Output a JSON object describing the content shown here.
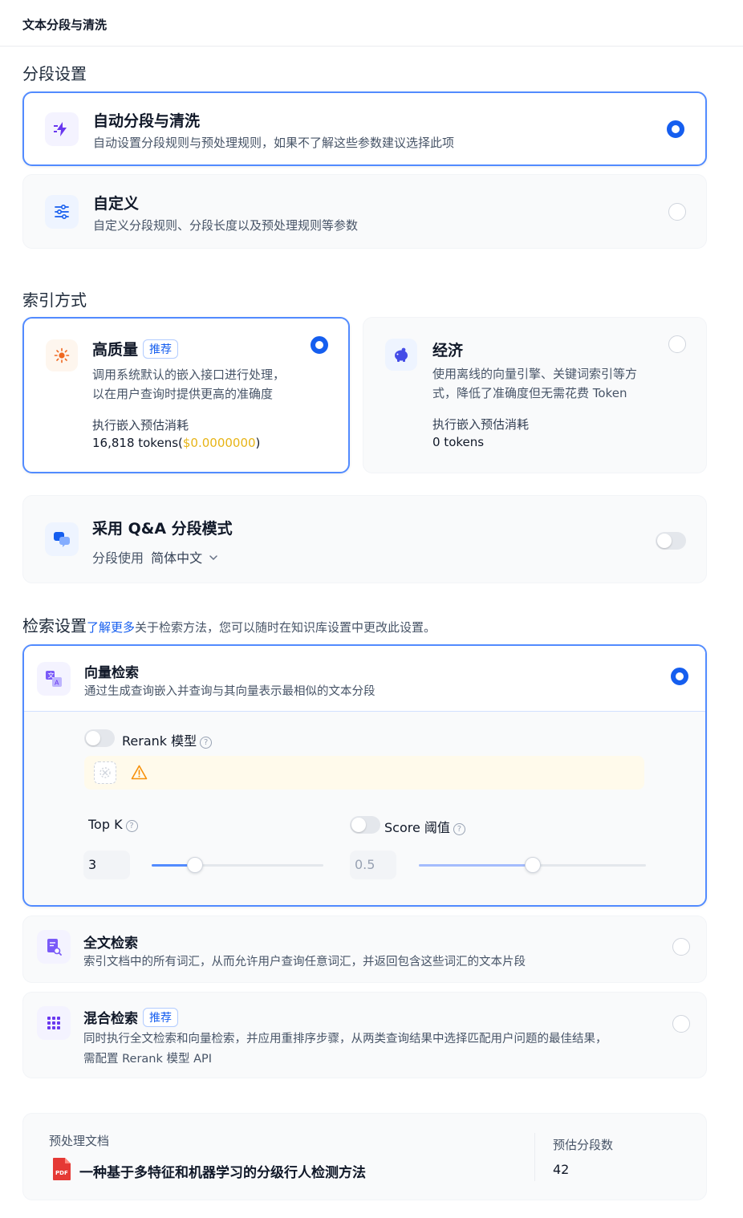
{
  "header": {
    "title": "文本分段与清洗"
  },
  "segmentation": {
    "title": "分段设置",
    "auto": {
      "title": "自动分段与清洗",
      "desc": "自动设置分段规则与预处理规则，如果不了解这些参数建议选择此项",
      "selected": true
    },
    "custom": {
      "title": "自定义",
      "desc": "自定义分段规则、分段长度以及预处理规则等参数",
      "selected": false
    }
  },
  "index": {
    "title": "索引方式",
    "high_quality": {
      "title": "高质量",
      "badge": "推荐",
      "desc_line1": "调用系统默认的嵌入接口进行处理，",
      "desc_line2": "以在用户查询时提供更高的准确度",
      "cost_label": "执行嵌入预估消耗",
      "tokens": "16,818 tokens(",
      "price": "$0.0000000",
      "tokens_end": ")",
      "selected": true
    },
    "economy": {
      "title": "经济",
      "desc_line1": "使用离线的向量引擎、关键词索引等方",
      "desc_line2": "式，降低了准确度但无需花费 Token",
      "cost_label": "执行嵌入预估消耗",
      "tokens": "0 tokens",
      "selected": false
    }
  },
  "qa": {
    "title": "采用 Q&A 分段模式",
    "lang_prefix": "分段使用",
    "lang_value": "简体中文",
    "enabled": false
  },
  "retrieval": {
    "title": "检索设置",
    "learn_more": "了解更多",
    "hint": "关于检索方法，您可以随时在知识库设置中更改此设置。",
    "vector": {
      "title": "向量检索",
      "desc": "通过生成查询嵌入并查询与其向量表示最相似的文本分段",
      "selected": true,
      "rerank_label": "Rerank 模型",
      "rerank_enabled": false,
      "topk_label": "Top K",
      "topk_value": "3",
      "topk_fraction": 0.25,
      "score_label": "Score 阈值",
      "score_enabled": false,
      "score_value": "0.5",
      "score_fraction": 0.5
    },
    "fulltext": {
      "title": "全文检索",
      "desc": "索引文档中的所有词汇，从而允许用户查询任意词汇，并返回包含这些词汇的文本片段",
      "selected": false
    },
    "hybrid": {
      "title": "混合检索",
      "badge": "推荐",
      "desc_line1": "同时执行全文检索和向量检索，并应用重排序步骤，从两类查询结果中选择匹配用户问题的最佳结果，",
      "desc_line2": "需配置 Rerank 模型 API",
      "selected": false
    }
  },
  "preview": {
    "doc_label": "预处理文档",
    "file_badge": "PDF",
    "doc_name": "一种基于多特征和机器学习的分级行人检测方法",
    "seg_label": "预估分段数",
    "seg_count": "42"
  },
  "colors": {
    "accent": "#155eef",
    "price": "#e7b416",
    "border_active": "#528bff"
  }
}
